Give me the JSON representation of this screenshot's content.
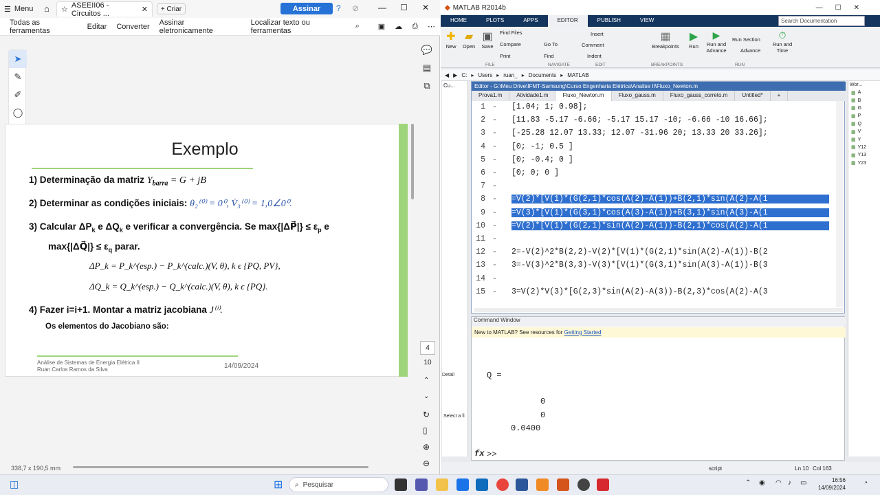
{
  "pdf": {
    "menu_label": "Menu",
    "tab_title": "ASEEII06 - Circuitos ...",
    "new_tab": "+ Criar",
    "sign_button": "Assinar",
    "toolbar": [
      "Todas as ferramentas",
      "Editar",
      "Converter",
      "Assinar eletronicamente"
    ],
    "search_placeholder": "Localizar texto ou ferramentas",
    "page_number": "4",
    "page_total": "10",
    "dimensions": "338,7 x 190,5 mm",
    "slide": {
      "title": "Exemplo",
      "item1": "1)   Determinação da matriz",
      "item1_math": "Y",
      "item1_math_sub": "barra",
      "item1_math_rest": " = G + jB",
      "item2": "2)   Determinar as condições iniciais:",
      "item2_math": "θ₂⁽⁰⁾ = 0⁰, V̇₃⁽⁰⁾ = 1,0∠0⁰.",
      "item3_a": "3)   Calcular ΔP",
      "item3_b": "e ΔQ",
      "item3_c": "e verificar a convergência. Se max{|ΔP⃗|} ≤ ε",
      "item3_d": "e",
      "item3_line2": "max{|ΔQ⃗|} ≤ ε",
      "item3_line2_end": "parar.",
      "eq1": "ΔP_k = P_k^(esp.) − P_k^(calc.)(V, θ),       k ϵ {PQ, PV},",
      "eq2": "ΔQ_k = Q_k^(esp.) − Q_k^(calc.)(V, θ),       k ϵ {PQ}.",
      "item4": "4)   Fazer i=i+1. Montar a matriz jacobiana",
      "item4_math": "J⁽ⁱ⁾.",
      "item5": "Os elementos do Jacobiano são:",
      "footer1": "Análise de Sistemas de Energia Elétrica II",
      "footer2": "Ruan Carlos Ramos da Silva",
      "footer_date": "14/09/2024"
    }
  },
  "matlab": {
    "title": "MATLAB R2014b",
    "tabs": [
      "HOME",
      "PLOTS",
      "APPS",
      "EDITOR",
      "PUBLISH",
      "VIEW"
    ],
    "search_placeholder": "Search Documentation",
    "ribbon": {
      "new": "New",
      "open": "Open",
      "save": "Save",
      "find_files": "Find Files",
      "compare": "Compare",
      "print": "Print",
      "go_to": "Go To",
      "find": "Find",
      "insert": "Insert",
      "comment": "Comment",
      "indent": "Indent",
      "breakpoints": "Breakpoints",
      "run": "Run",
      "run_advance": "Run and Advance",
      "run_section": "Run Section",
      "advance": "Advance",
      "run_time": "Run and Time",
      "sections": [
        "FILE",
        "NAVIGATE",
        "EDIT",
        "BREAKPOINTS",
        "RUN"
      ]
    },
    "path": [
      "C:",
      "Users",
      "ruan_",
      "Documents",
      "MATLAB"
    ],
    "editor_title": "Editor - G:\\Meu Drive\\IFMT-Samsung\\Curso Engenharia Elétrica\\Analise II\\Fluxo_Newton.m",
    "editor_tabs": [
      "Prova1.m",
      "Atividade1.m",
      "Fluxo_Newton.m",
      "Fluxo_gauss.m",
      "Fluxo_gauss_correto.m",
      "Untitled*"
    ],
    "code": [
      {
        "n": "1",
        "t": "[1.04; 1; 0.98];",
        "sel": false
      },
      {
        "n": "2",
        "t": "[11.83 -5.17 -6.66; -5.17 15.17 -10; -6.66 -10 16.66];",
        "sel": false
      },
      {
        "n": "3",
        "t": "[-25.28 12.07 13.33; 12.07 -31.96 20; 13.33 20 33.26];",
        "sel": false
      },
      {
        "n": "4",
        "t": "[0; -1; 0.5 ]",
        "sel": false
      },
      {
        "n": "5",
        "t": "[0; -0.4; 0 ]",
        "sel": false
      },
      {
        "n": "6",
        "t": "[0; 0; 0 ]",
        "sel": false
      },
      {
        "n": "7",
        "t": "",
        "sel": false
      },
      {
        "n": "8",
        "t": "=V(2)*[V(1)*(G(2,1)*cos(A(2)-A(1))+B(2,1)*sin(A(2)-A(1",
        "sel": true
      },
      {
        "n": "9",
        "t": "=V(3)*[V(1)*(G(3,1)*cos(A(3)-A(1))+B(3,1)*sin(A(3)-A(1",
        "sel": true
      },
      {
        "n": "10",
        "t": "=V(2)*[V(1)*(G(2,1)*sin(A(2)-A(1))-B(2,1)*cos(A(2)-A(1",
        "sel": true
      },
      {
        "n": "11",
        "t": "",
        "sel": false
      },
      {
        "n": "12",
        "t": "2=-V(2)^2*B(2,2)-V(2)*[V(1)*(G(2,1)*sin(A(2)-A(1))-B(2",
        "sel": false
      },
      {
        "n": "13",
        "t": "3=-V(3)^2*B(3,3)-V(3)*[V(1)*(G(3,1)*sin(A(3)-A(1))-B(3",
        "sel": false
      },
      {
        "n": "14",
        "t": "",
        "sel": false
      },
      {
        "n": "15",
        "t": "3=V(2)*V(3)*[G(2,3)*sin(A(2)-A(3))-B(2,3)*cos(A(2)-A(3",
        "sel": false
      }
    ],
    "command_window_label": "Command Window",
    "cmd_note": "New to MATLAB? See resources for",
    "cmd_note_link": "Getting Started",
    "cmd_var": "Q =",
    "cmd_values": [
      "0",
      "0",
      "0.0400"
    ],
    "prompt": ">>",
    "current_folder": "Cu...",
    "workspace_label": "Wor...",
    "workspace_vars": [
      "A",
      "B",
      "G",
      "P",
      "Q",
      "V",
      "Y",
      "Y12",
      "Y13",
      "Y23"
    ],
    "detail_label": "Detail",
    "select_label": "Select a fi",
    "status_script": "script",
    "status_ln": "Ln  10",
    "status_col": "Col  163"
  },
  "taskbar": {
    "search_placeholder": "Pesquisar",
    "time": "16:56",
    "date": "14/09/2024"
  }
}
